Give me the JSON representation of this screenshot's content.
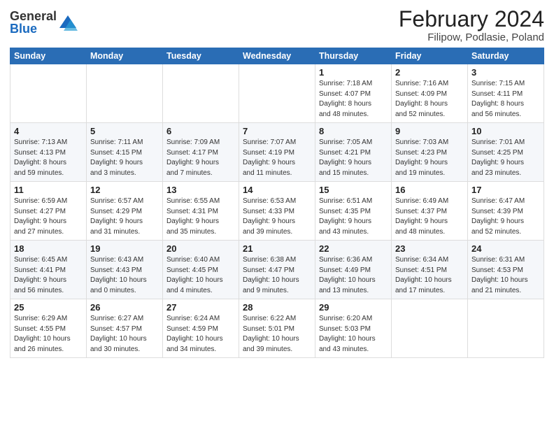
{
  "logo": {
    "general": "General",
    "blue": "Blue"
  },
  "title": "February 2024",
  "subtitle": "Filipow, Podlasie, Poland",
  "days_of_week": [
    "Sunday",
    "Monday",
    "Tuesday",
    "Wednesday",
    "Thursday",
    "Friday",
    "Saturday"
  ],
  "weeks": [
    [
      {
        "day": "",
        "info": ""
      },
      {
        "day": "",
        "info": ""
      },
      {
        "day": "",
        "info": ""
      },
      {
        "day": "",
        "info": ""
      },
      {
        "day": "1",
        "info": "Sunrise: 7:18 AM\nSunset: 4:07 PM\nDaylight: 8 hours\nand 48 minutes."
      },
      {
        "day": "2",
        "info": "Sunrise: 7:16 AM\nSunset: 4:09 PM\nDaylight: 8 hours\nand 52 minutes."
      },
      {
        "day": "3",
        "info": "Sunrise: 7:15 AM\nSunset: 4:11 PM\nDaylight: 8 hours\nand 56 minutes."
      }
    ],
    [
      {
        "day": "4",
        "info": "Sunrise: 7:13 AM\nSunset: 4:13 PM\nDaylight: 8 hours\nand 59 minutes."
      },
      {
        "day": "5",
        "info": "Sunrise: 7:11 AM\nSunset: 4:15 PM\nDaylight: 9 hours\nand 3 minutes."
      },
      {
        "day": "6",
        "info": "Sunrise: 7:09 AM\nSunset: 4:17 PM\nDaylight: 9 hours\nand 7 minutes."
      },
      {
        "day": "7",
        "info": "Sunrise: 7:07 AM\nSunset: 4:19 PM\nDaylight: 9 hours\nand 11 minutes."
      },
      {
        "day": "8",
        "info": "Sunrise: 7:05 AM\nSunset: 4:21 PM\nDaylight: 9 hours\nand 15 minutes."
      },
      {
        "day": "9",
        "info": "Sunrise: 7:03 AM\nSunset: 4:23 PM\nDaylight: 9 hours\nand 19 minutes."
      },
      {
        "day": "10",
        "info": "Sunrise: 7:01 AM\nSunset: 4:25 PM\nDaylight: 9 hours\nand 23 minutes."
      }
    ],
    [
      {
        "day": "11",
        "info": "Sunrise: 6:59 AM\nSunset: 4:27 PM\nDaylight: 9 hours\nand 27 minutes."
      },
      {
        "day": "12",
        "info": "Sunrise: 6:57 AM\nSunset: 4:29 PM\nDaylight: 9 hours\nand 31 minutes."
      },
      {
        "day": "13",
        "info": "Sunrise: 6:55 AM\nSunset: 4:31 PM\nDaylight: 9 hours\nand 35 minutes."
      },
      {
        "day": "14",
        "info": "Sunrise: 6:53 AM\nSunset: 4:33 PM\nDaylight: 9 hours\nand 39 minutes."
      },
      {
        "day": "15",
        "info": "Sunrise: 6:51 AM\nSunset: 4:35 PM\nDaylight: 9 hours\nand 43 minutes."
      },
      {
        "day": "16",
        "info": "Sunrise: 6:49 AM\nSunset: 4:37 PM\nDaylight: 9 hours\nand 48 minutes."
      },
      {
        "day": "17",
        "info": "Sunrise: 6:47 AM\nSunset: 4:39 PM\nDaylight: 9 hours\nand 52 minutes."
      }
    ],
    [
      {
        "day": "18",
        "info": "Sunrise: 6:45 AM\nSunset: 4:41 PM\nDaylight: 9 hours\nand 56 minutes."
      },
      {
        "day": "19",
        "info": "Sunrise: 6:43 AM\nSunset: 4:43 PM\nDaylight: 10 hours\nand 0 minutes."
      },
      {
        "day": "20",
        "info": "Sunrise: 6:40 AM\nSunset: 4:45 PM\nDaylight: 10 hours\nand 4 minutes."
      },
      {
        "day": "21",
        "info": "Sunrise: 6:38 AM\nSunset: 4:47 PM\nDaylight: 10 hours\nand 9 minutes."
      },
      {
        "day": "22",
        "info": "Sunrise: 6:36 AM\nSunset: 4:49 PM\nDaylight: 10 hours\nand 13 minutes."
      },
      {
        "day": "23",
        "info": "Sunrise: 6:34 AM\nSunset: 4:51 PM\nDaylight: 10 hours\nand 17 minutes."
      },
      {
        "day": "24",
        "info": "Sunrise: 6:31 AM\nSunset: 4:53 PM\nDaylight: 10 hours\nand 21 minutes."
      }
    ],
    [
      {
        "day": "25",
        "info": "Sunrise: 6:29 AM\nSunset: 4:55 PM\nDaylight: 10 hours\nand 26 minutes."
      },
      {
        "day": "26",
        "info": "Sunrise: 6:27 AM\nSunset: 4:57 PM\nDaylight: 10 hours\nand 30 minutes."
      },
      {
        "day": "27",
        "info": "Sunrise: 6:24 AM\nSunset: 4:59 PM\nDaylight: 10 hours\nand 34 minutes."
      },
      {
        "day": "28",
        "info": "Sunrise: 6:22 AM\nSunset: 5:01 PM\nDaylight: 10 hours\nand 39 minutes."
      },
      {
        "day": "29",
        "info": "Sunrise: 6:20 AM\nSunset: 5:03 PM\nDaylight: 10 hours\nand 43 minutes."
      },
      {
        "day": "",
        "info": ""
      },
      {
        "day": "",
        "info": ""
      }
    ]
  ]
}
